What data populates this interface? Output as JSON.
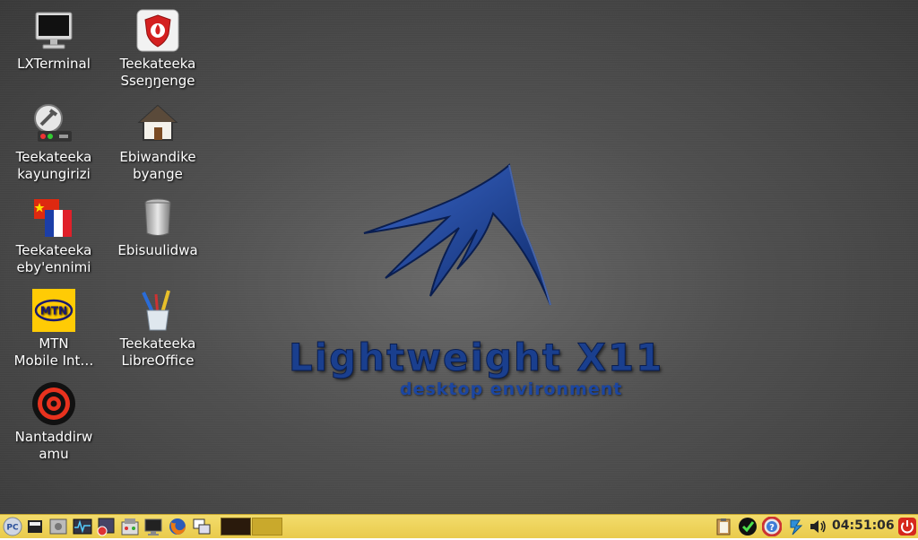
{
  "desktop": {
    "icons": [
      {
        "label": "LXTerminal",
        "icon": "monitor-icon"
      },
      {
        "label": "Teekateeka\nSseŋŋenge",
        "icon": "firewall-shield-icon"
      },
      {
        "label": "Teekateeka\nkayungirizi",
        "icon": "settings-wrench-icon"
      },
      {
        "label": "Ebiwandike\nbyange",
        "icon": "home-icon"
      },
      {
        "label": "Teekateeka\neby'ennimi",
        "icon": "language-flags-icon"
      },
      {
        "label": "Ebisuulidwa",
        "icon": "trash-can-icon"
      },
      {
        "label": "MTN\nMobile Int…",
        "icon": "mtn-logo-icon"
      },
      {
        "label": "Teekateeka\nLibreOffice",
        "icon": "pencil-cup-icon"
      },
      {
        "label": "Nantaddirw\namu",
        "icon": "target-icon"
      }
    ]
  },
  "wallpaper": {
    "title": "Lightweight X11",
    "subtitle": "desktop environment",
    "accent_color": "#1a3f8e"
  },
  "taskbar": {
    "background": "#f0d35a",
    "launchers": [
      "start-menu-icon",
      "minimize-all-icon",
      "file-manager-icon",
      "task-monitor-icon",
      "image-viewer-icon",
      "software-center-icon",
      "terminal-icon",
      "firefox-icon",
      "window-switcher-icon"
    ],
    "tray": [
      "clipboard-icon",
      "update-check-icon",
      "help-icon",
      "network-sync-icon",
      "volume-icon"
    ],
    "clock": "04:51:06",
    "power": "power-icon"
  }
}
